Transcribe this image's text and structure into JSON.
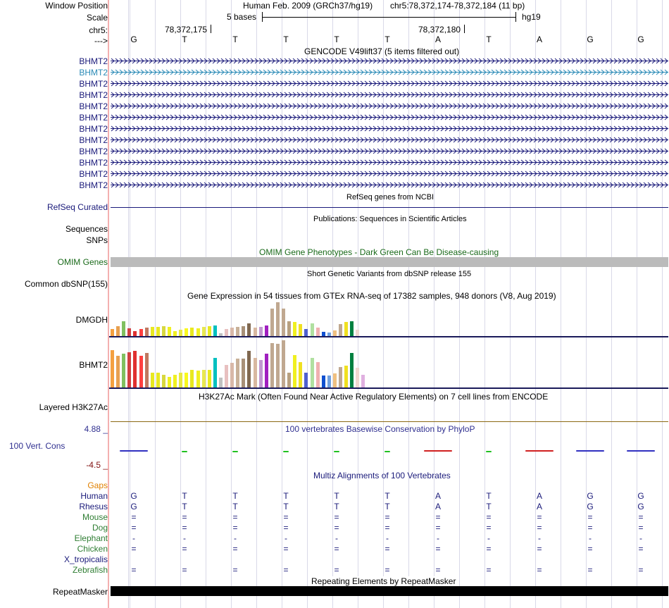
{
  "header": {
    "window_position_label": "Window Position",
    "scale_label": "Scale",
    "chrom_label": "chr5:",
    "strand_label": "--->",
    "assembly_text": "Human Feb. 2009 (GRCh37/hg19)",
    "position_text": "chr5:78,372,174-78,372,184 (11 bp)",
    "scale_text": "5 bases",
    "db_label": "hg19",
    "coord1": "78,372,175",
    "coord2": "78,372,180"
  },
  "bases": [
    "G",
    "T",
    "T",
    "T",
    "T",
    "T",
    "A",
    "T",
    "A",
    "G",
    "G"
  ],
  "gencode": {
    "title": "GENCODE V49lift37 (5 items filtered out)",
    "rows": [
      {
        "label": "BHMT2",
        "color": "#1a1a7a"
      },
      {
        "label": "BHMT2",
        "color": "#2a8ab6"
      },
      {
        "label": "BHMT2",
        "color": "#1a1a7a"
      },
      {
        "label": "BHMT2",
        "color": "#1a1a7a"
      },
      {
        "label": "BHMT2",
        "color": "#1a1a7a"
      },
      {
        "label": "BHMT2",
        "color": "#1a1a7a"
      },
      {
        "label": "BHMT2",
        "color": "#1a1a7a"
      },
      {
        "label": "BHMT2",
        "color": "#1a1a7a"
      },
      {
        "label": "BHMT2",
        "color": "#1a1a7a"
      },
      {
        "label": "BHMT2",
        "color": "#1a1a7a"
      },
      {
        "label": "BHMT2",
        "color": "#1a1a7a"
      },
      {
        "label": "BHMT2",
        "color": "#1a1a7a"
      }
    ]
  },
  "refseq": {
    "title": "RefSeq genes from NCBI",
    "label": "RefSeq Curated"
  },
  "pubs": {
    "title": "Publications: Sequences in Scientific Articles",
    "label1": "Sequences",
    "label2": "SNPs"
  },
  "omim": {
    "title": "OMIM Gene Phenotypes - Dark Green Can Be Disease-causing",
    "label": "OMIM Genes"
  },
  "dbsnp": {
    "title": "Short Genetic Variants from dbSNP release 155",
    "label": "Common dbSNP(155)"
  },
  "gtex": {
    "title": "Gene Expression in 54 tissues from GTEx RNA-seq of 17382 samples, 948 donors (V8, Aug 2019)",
    "colors": [
      "#f4a040",
      "#e8a050",
      "#80c060",
      "#d04040",
      "#e03030",
      "#ff4040",
      "#c07860",
      "#e8e820",
      "#e8e820",
      "#d8d840",
      "#f0f020",
      "#f0f020",
      "#e8e840",
      "#f8f820",
      "#e8e820",
      "#f0f020",
      "#e8e850",
      "#e8e820",
      "#00c0c0",
      "#c0c0c0",
      "#e8c0c0",
      "#d8b8a8",
      "#c8b098",
      "#a89078",
      "#806850",
      "#d8b8a0",
      "#c098d0",
      "#a020c0",
      "#c0a890",
      "#c0a890",
      "#c0a890",
      "#b8a080",
      "#f0f020",
      "#f0e020",
      "#5060d0",
      "#b0e0a0",
      "#f0b0b0",
      "#1050d0",
      "#70a0e0",
      "#f0c080",
      "#c0a890",
      "#f0e020",
      "#008040",
      "#f0d8d0",
      "#e0b0e0",
      "#c060c0"
    ],
    "rows": [
      {
        "label": "DMGDH",
        "values": [
          0.2,
          0.28,
          0.42,
          0.22,
          0.14,
          0.2,
          0.24,
          0.26,
          0.26,
          0.28,
          0.26,
          0.14,
          0.18,
          0.22,
          0.24,
          0.22,
          0.26,
          0.28,
          0.3,
          0.08,
          0.2,
          0.24,
          0.26,
          0.28,
          0.36,
          0.24,
          0.26,
          0.3,
          0.78,
          0.96,
          0.78,
          0.42,
          0.4,
          0.34,
          0.2,
          0.36,
          0.24,
          0.12,
          0.1,
          0.16,
          0.34,
          0.4,
          0.42,
          0.18,
          0.0,
          0.0
        ]
      },
      {
        "label": "BHMT2",
        "values": [
          0.75,
          0.64,
          0.68,
          0.72,
          0.74,
          0.64,
          0.7,
          0.3,
          0.3,
          0.26,
          0.22,
          0.26,
          0.3,
          0.3,
          0.36,
          0.34,
          0.36,
          0.36,
          0.6,
          0.2,
          0.46,
          0.5,
          0.58,
          0.58,
          0.74,
          0.6,
          0.56,
          0.68,
          0.9,
          0.88,
          0.96,
          0.3,
          0.65,
          0.52,
          0.3,
          0.6,
          0.52,
          0.24,
          0.24,
          0.28,
          0.42,
          0.44,
          0.7,
          0.4,
          0.26,
          0.0
        ]
      }
    ]
  },
  "h3k27ac": {
    "title": "H3K27Ac Mark (Often Found Near Active Regulatory Elements) on 7 cell lines from ENCODE",
    "label": "Layered H3K27Ac"
  },
  "phylop": {
    "title": "100 vertebrates Basewise Conservation by PhyloP",
    "label": "100 Vert. Cons",
    "max_label": "4.88 _",
    "min_label": "-4.5 _",
    "values": [
      -0.25,
      0.55,
      0.45,
      0.5,
      0.45,
      0.5,
      -0.4,
      0.5,
      -0.45,
      -0.2,
      -0.2
    ]
  },
  "multiz": {
    "title": "Multiz Alignments of 100 Vertebrates",
    "gaps_label": "Gaps",
    "species": [
      {
        "name": "Human",
        "color": "#1a1a7a",
        "bases": [
          "G",
          "T",
          "T",
          "T",
          "T",
          "T",
          "A",
          "T",
          "A",
          "G",
          "G"
        ]
      },
      {
        "name": "Rhesus",
        "color": "#1a1a7a",
        "bases": [
          "G",
          "T",
          "T",
          "T",
          "T",
          "T",
          "A",
          "T",
          "A",
          "G",
          "G"
        ]
      },
      {
        "name": "Mouse",
        "color": "#2e7d32",
        "bases": [
          "=",
          "=",
          "=",
          "=",
          "=",
          "=",
          "=",
          "=",
          "=",
          "=",
          "="
        ]
      },
      {
        "name": "Dog",
        "color": "#2e7d32",
        "bases": [
          "=",
          "=",
          "=",
          "=",
          "=",
          "=",
          "=",
          "=",
          "=",
          "=",
          "="
        ]
      },
      {
        "name": "Elephant",
        "color": "#2e7d32",
        "bases": [
          "-",
          "-",
          "-",
          "-",
          "-",
          "-",
          "-",
          "-",
          "-",
          "-",
          "-"
        ]
      },
      {
        "name": "Chicken",
        "color": "#2e7d32",
        "bases": [
          "=",
          "=",
          "=",
          "=",
          "=",
          "=",
          "=",
          "=",
          "=",
          "=",
          "="
        ]
      },
      {
        "name": "X_tropicalis",
        "color": "#1a1a7a",
        "bases": [
          "",
          "",
          "",
          "",
          "",
          "",
          "",
          "",
          "",
          "",
          ""
        ]
      },
      {
        "name": "Zebrafish",
        "color": "#2e7d32",
        "bases": [
          "=",
          "=",
          "=",
          "=",
          "=",
          "=",
          "=",
          "=",
          "=",
          "=",
          "="
        ]
      }
    ]
  },
  "repeatmasker": {
    "title": "Repeating Elements by RepeatMasker",
    "label": "RepeatMasker"
  },
  "colors": {
    "navy": "#1a1a7a",
    "green": "#2e7d32",
    "orange": "#e08000",
    "omim_green": "#1a6a1a",
    "phylop_blue": "#303090",
    "red": "#801010"
  }
}
